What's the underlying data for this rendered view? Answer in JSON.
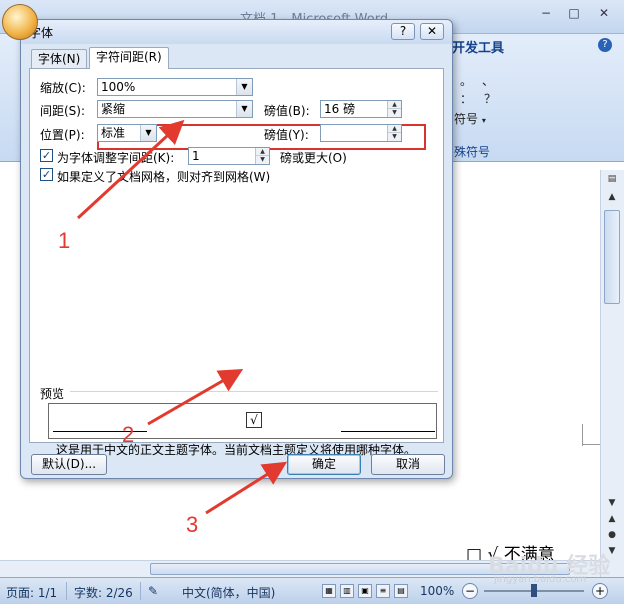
{
  "window": {
    "title": "文档 1 - Microsoft Word",
    "minimize": "−",
    "maximize": "□",
    "close": "✕"
  },
  "ribbon": {
    "tab_developer": "开发工具",
    "help": "?",
    "symbols": [
      "。",
      "、",
      "：",
      "？"
    ],
    "symbol_button": "符号",
    "group_label": "殊符号"
  },
  "document": {
    "text": "□ √ 不满意"
  },
  "statusbar": {
    "page": "页面: 1/1",
    "words": "字数: 2/26",
    "language": "中文(简体，中国)",
    "zoom": "100%",
    "zoom_minus": "−",
    "zoom_plus": "+"
  },
  "watermark": {
    "logo": "Baidu 经验",
    "url": "jingyan.baidu.com"
  },
  "dialog": {
    "title": "字体",
    "help_btn": "?",
    "close_btn": "✕",
    "tabs": [
      {
        "label": "字体(N)",
        "active": false
      },
      {
        "label": "字符间距(R)",
        "active": true
      }
    ],
    "scale": {
      "label": "缩放(C):",
      "value": "100%"
    },
    "spacing": {
      "label": "间距(S):",
      "value": "紧缩",
      "by_label": "磅值(B):",
      "by_value": "16 磅"
    },
    "position": {
      "label": "位置(P):",
      "value": "标准",
      "by_label": "磅值(Y):",
      "by_value": ""
    },
    "kerning": {
      "checked": true,
      "label": "为字体调整字间距(K):",
      "value": "1",
      "suffix": "磅或更大(O)"
    },
    "grid": {
      "checked": true,
      "label": "如果定义了文档网格，则对齐到网格(W)"
    },
    "preview": {
      "label": "预览",
      "glyph": "√",
      "description": "这是用于中文的正文主题字体。当前文档主题定义将使用哪种字体。"
    },
    "buttons": {
      "default": "默认(D)...",
      "ok": "确定",
      "cancel": "取消"
    }
  },
  "annotations": [
    "1",
    "2",
    "3"
  ],
  "colors": {
    "annotation": "#e23a2f",
    "highlight": "#d9342b",
    "dialog_bg": "#dce7f5"
  }
}
